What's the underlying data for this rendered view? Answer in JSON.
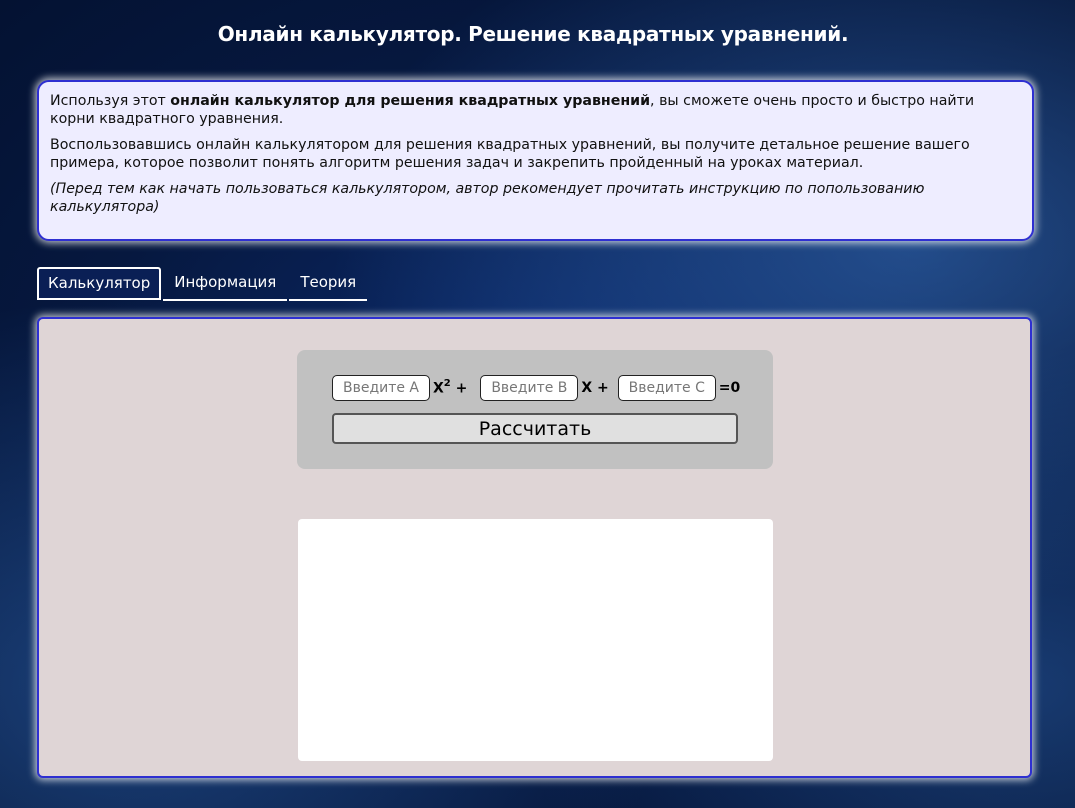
{
  "header": {
    "title": "Онлайн калькулятор. Решение квадратных уравнений."
  },
  "intro": {
    "p1_before": "Используя этот ",
    "p1_bold": "онлайн калькулятор для решения квадратных уравнений",
    "p1_after": ", вы сможете очень просто и быстро найти корни квадратного уравнения.",
    "p2": "Воспользовавшись онлайн калькулятором для решения квадратных уравнений, вы получите детальное решение вашего примера, которое позволит понять алгоритм решения задач и закрепить пройденный на уроках материал.",
    "note": "(Перед тем как начать пользоваться калькулятором, автор рекомендует прочитать инструкцию по попользованию калькулятора)"
  },
  "tabs": [
    {
      "label": "Калькулятор",
      "active": true
    },
    {
      "label": "Информация",
      "active": false
    },
    {
      "label": "Теория",
      "active": false
    }
  ],
  "calculator": {
    "input_a_placeholder": "Введите A",
    "input_a_value": "",
    "term_a": "X",
    "term_a_exp": "2",
    "plus_1": "+",
    "input_b_placeholder": "Введите B",
    "input_b_value": "",
    "term_b": "X +",
    "input_c_placeholder": "Введите C",
    "input_c_value": "",
    "equals": "=0",
    "calculate_label": "Рассчитать"
  },
  "colors": {
    "accent_border": "#2e2fd1",
    "panel_bg": "#dfd5d6",
    "intro_bg": "#eeedff"
  }
}
